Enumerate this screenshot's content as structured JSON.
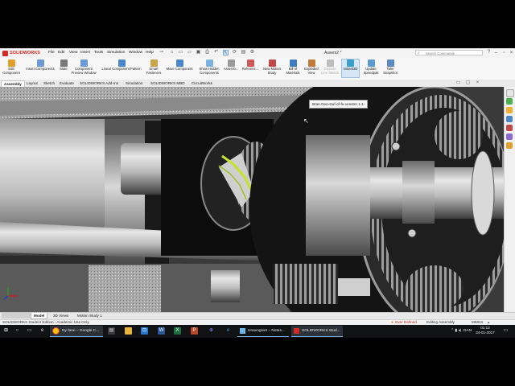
{
  "app": {
    "brand": "SOLIDWORKS",
    "document_title": "Assem2 *",
    "menu": [
      "File",
      "Edit",
      "View",
      "Insert",
      "Tools",
      "Simulation",
      "Window",
      "Help"
    ],
    "search_placeholder": "Search Commands"
  },
  "ribbon": {
    "buttons": [
      {
        "label": "Edit Component",
        "color": "#e0a030"
      },
      {
        "label": "Insert Components",
        "color": "#6b9ad6"
      },
      {
        "label": "Mate",
        "color": "#7a7a7a"
      },
      {
        "label": "Component Preview Window",
        "color": "#6b9ad6"
      },
      {
        "label": "Linear Component Pattern",
        "color": "#4a86c8"
      },
      {
        "label": "Smart Fasteners",
        "color": "#c9a44a"
      },
      {
        "label": "Move Component",
        "color": "#4a86c8"
      },
      {
        "label": "Show Hidden Components",
        "color": "#7bb3e0"
      },
      {
        "label": "Assemb...",
        "color": "#9a9a9a"
      },
      {
        "label": "Referenc...",
        "color": "#d05a5a"
      },
      {
        "label": "New Motion Study",
        "color": "#c04848"
      },
      {
        "label": "Bill of Materials",
        "color": "#3f7cc0"
      },
      {
        "label": "Exploded View",
        "color": "#c07a3a"
      },
      {
        "label": "Explode Line Sketch",
        "color": "#bdbdbd"
      },
      {
        "label": "Instant3D",
        "color": "#3aa0c8"
      },
      {
        "label": "Update Speedpak",
        "color": "#5a9ad0"
      },
      {
        "label": "Take Snapshot",
        "color": "#5a8ac0"
      }
    ]
  },
  "tabs": [
    "Assembly",
    "Layout",
    "Sketch",
    "Evaluate",
    "SOLIDWORKS Add-Ins",
    "Simulation",
    "SOLIDWORKS MBD",
    "CircuitWorks"
  ],
  "tooltip": "Bras-Gen-stuf-of-fe-venstre 1-1-",
  "bottom_tabs": [
    "Model",
    "3D Views",
    "Motion Study 1"
  ],
  "status": {
    "left": "SOLIDWORKS Student Edition - Academic Use Only",
    "over_defined": "Over Defined",
    "editing": "Editing Assembly",
    "units": "MMGS"
  },
  "taskbar": {
    "apps": [
      {
        "label": "Ny fane – Google C...",
        "color": "#f4c20d"
      },
      {
        "label": "Unavngivet – Notes...",
        "color": "#6fb7e8"
      },
      {
        "label": "SOLIDWORKS Stud...",
        "color": "#d42a25"
      }
    ],
    "language": "DAN",
    "time": "01:12",
    "date": "24-01-2017"
  }
}
